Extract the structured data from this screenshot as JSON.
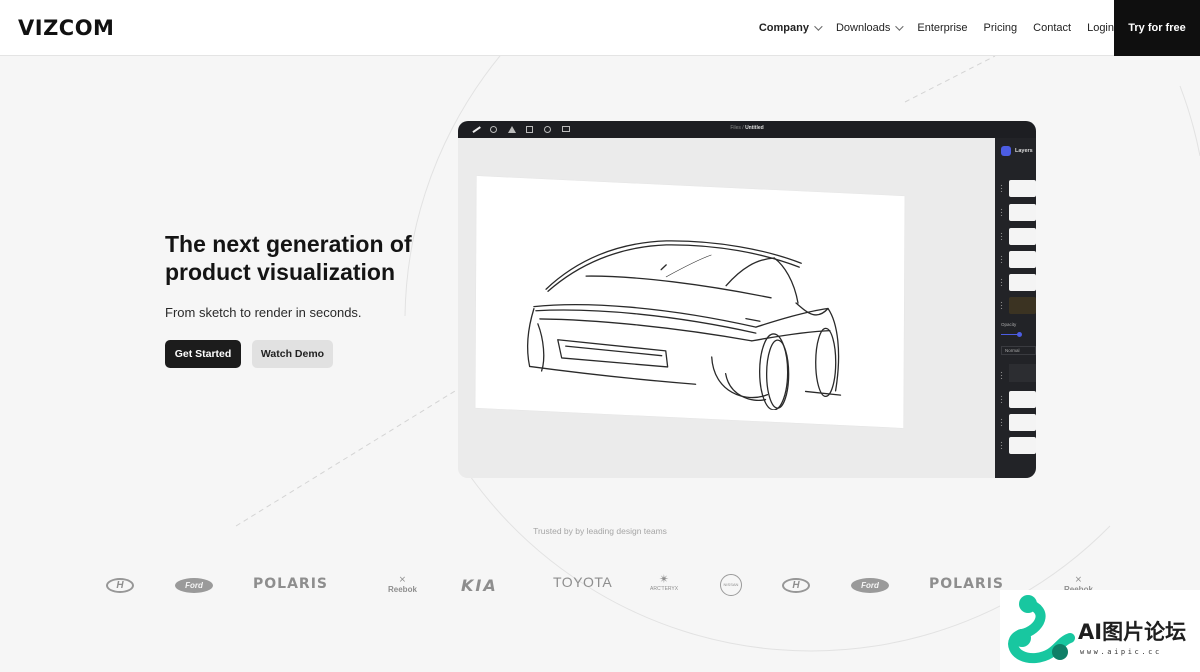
{
  "header": {
    "logo": "VIZCOM",
    "nav": [
      {
        "label": "Company",
        "dropdown": true
      },
      {
        "label": "Downloads",
        "dropdown": true
      },
      {
        "label": "Enterprise",
        "dropdown": false
      },
      {
        "label": "Pricing",
        "dropdown": false
      },
      {
        "label": "Contact",
        "dropdown": false
      },
      {
        "label": "Login",
        "dropdown": false
      }
    ],
    "cta": "Try for free"
  },
  "hero": {
    "title": "The next generation of product visualization",
    "subtitle": "From sketch to render in seconds.",
    "primary_button": "Get Started",
    "secondary_button": "Watch Demo"
  },
  "app_preview": {
    "path_prefix": "Files /",
    "file_name": "Untitled",
    "panel_title": "Layers",
    "opacity_label": "Opacity",
    "blend_mode": "Normal",
    "accent_color": "#4c5de3"
  },
  "trusted": {
    "text": "Trusted by by leading design teams",
    "logos": [
      "Hyundai",
      "Ford",
      "POLARIS",
      "Reebok",
      "KIA",
      "TOYOTA",
      "ARC'TERYX",
      "NISSAN",
      "Hyundai",
      "Ford",
      "POLARIS",
      "Reebok"
    ],
    "wordmarks": {
      "polaris": "POLARIS",
      "kia": "KIA",
      "toyota": "TOYOTA",
      "arcteryx": "ARC'TERYX",
      "nissan": "NISSAN",
      "ford": "Ford",
      "reebok": "Reebok"
    }
  },
  "watermark": {
    "text": "AI图片论坛",
    "url": "www.aipic.cc"
  },
  "colors": {
    "background": "#f6f6f6",
    "header_background": "#ffffff",
    "cta_background": "#0f0f0f",
    "primary_button": "#1c1c1c",
    "secondary_button": "#e1e1e1",
    "app_toolbar": "#1d1e22",
    "watermark_green": "#18c7a0"
  }
}
